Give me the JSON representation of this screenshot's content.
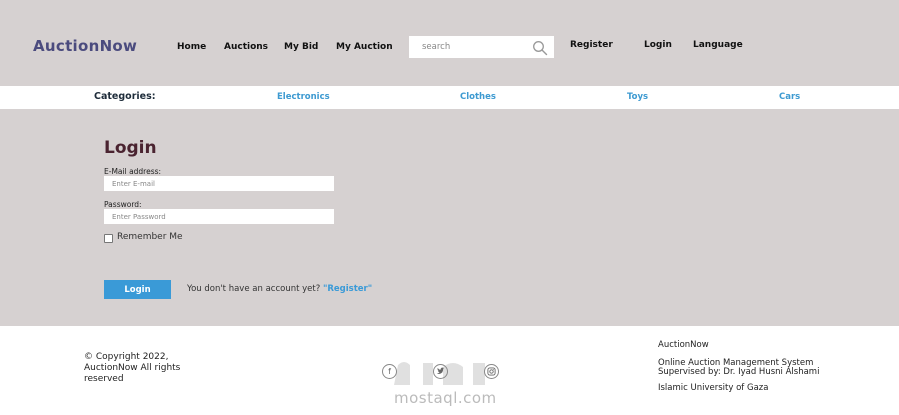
{
  "header": {
    "logo": "AuctionNow",
    "nav": [
      "Home",
      "Auctions",
      "My Bid",
      "My Auction"
    ],
    "search_placeholder": "search",
    "register": "Register",
    "login": "Login",
    "language": "Language"
  },
  "categories": {
    "title": "Categories:",
    "items": [
      "Electronics",
      "Clothes",
      "Toys",
      "Cars"
    ]
  },
  "login_form": {
    "title": "Login",
    "email_label": "E-Mail address:",
    "email_placeholder": "Enter E-mail",
    "password_label": "Password:",
    "password_placeholder": "Enter Password",
    "remember_label": "Remember Me",
    "submit_label": "Login",
    "no_account_text": "You don't have an account yet?",
    "register_link": "\"Register\""
  },
  "footer": {
    "copyright": "© Copyright 2022, AuctionNow All rights reserved",
    "brand": "AuctionNow",
    "description_line1": "Online Auction Management System",
    "description_line2": "Supervised by: Dr. Iyad Husni Alshami",
    "university": "Islamic University of Gaza",
    "social_icons": [
      "facebook-icon",
      "twitter-icon",
      "instagram-icon"
    ],
    "watermark_text": "mostaql.com"
  },
  "colors": {
    "background": "#d6d1d1",
    "logo": "#4b4b7e",
    "accent": "#3a9ad7",
    "login_title": "#4a2330"
  }
}
